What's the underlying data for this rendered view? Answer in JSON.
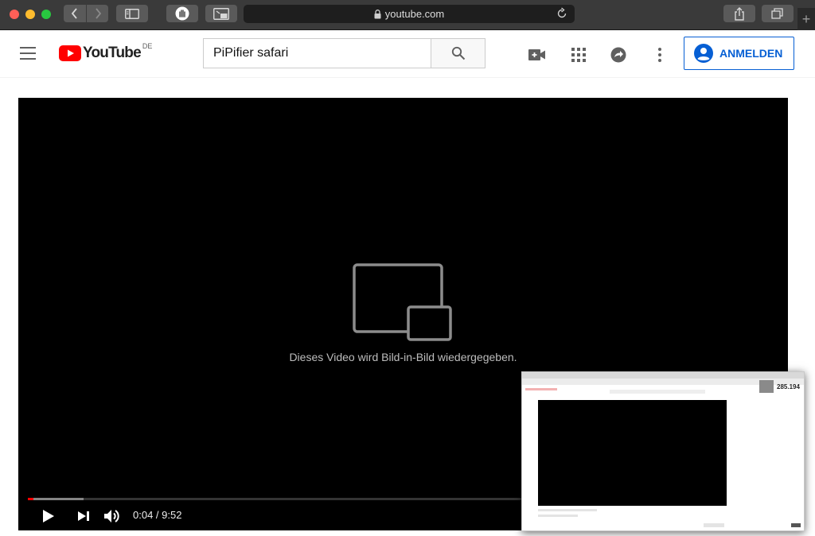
{
  "browser": {
    "url": "youtube.com"
  },
  "youtube": {
    "logo_text": "YouTube",
    "region": "DE",
    "search_value": "PiPifier safari",
    "signin_label": "ANMELDEN"
  },
  "player": {
    "pip_message": "Dieses Video wird Bild-in-Bild wiedergegeben.",
    "current_time": "0:04",
    "duration": "9:52",
    "time_display": "0:04 / 9:52",
    "progress_played_fraction": 0.0072,
    "progress_buffered_fraction": 0.074
  },
  "pip_window": {
    "count": "285.194"
  },
  "colors": {
    "youtube_red": "#ff0000",
    "signin_blue": "#065fd4",
    "safari_bar": "#3a3a3a"
  },
  "icons": [
    "sidebar-icon",
    "privacy-hand-icon",
    "pip-toggle-icon",
    "lock-icon",
    "reload-icon",
    "share-icon",
    "tabs-icon",
    "new-tab-icon",
    "menu-icon",
    "search-icon",
    "create-video-icon",
    "apps-grid-icon",
    "share-arrow-icon",
    "more-vert-icon",
    "account-icon",
    "pip-icon",
    "play-icon",
    "next-icon",
    "volume-icon"
  ]
}
